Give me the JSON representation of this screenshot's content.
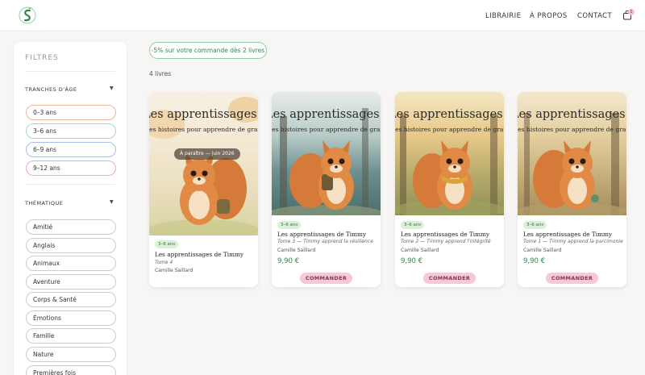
{
  "header": {
    "nav": [
      "LIBRAIRIE",
      "À PROPOS",
      "CONTACT"
    ],
    "cart_count": "1",
    "colors": {
      "accent": "#2f8a4a",
      "pink": "#f7c9d6"
    }
  },
  "sidebar": {
    "title": "FILTRES",
    "age_section": "TRANCHES D'ÂGE",
    "age_options": [
      "0–3 ans",
      "3–6 ans",
      "6–9 ans",
      "9–12 ans"
    ],
    "theme_section": "THÉMATIQUE",
    "theme_options": [
      "Amitié",
      "Anglais",
      "Animaux",
      "Aventure",
      "Corps & Santé",
      "Émotions",
      "Famille",
      "Nature",
      "Premières fois"
    ]
  },
  "main": {
    "promo": "-5% sur votre commande dès 2 livres",
    "count": "4 livres",
    "books": [
      {
        "cover_title": "Les apprentissages de Timmy",
        "cover_sub": "Des histoires pour apprendre de grandes",
        "coming": "À paraître — juin 2026",
        "age": "3–6 ans",
        "title": "Les apprentissages de Timmy",
        "subtitle": "Tome 4",
        "author": "Camille Saillard"
      },
      {
        "cover_title": "Les apprentissages de Timmy",
        "cover_sub": "Des histoires pour apprendre de grandes",
        "age": "3–6 ans",
        "title": "Les apprentissages de Timmy",
        "subtitle": "Tome 3 — Timmy apprend la résilience",
        "author": "Camille Saillard",
        "price": "9,90 €",
        "button": "COMMANDER"
      },
      {
        "cover_title": "Les apprentissages de Timmy",
        "cover_sub": "Des histoires pour apprendre de grandes",
        "age": "3–6 ans",
        "title": "Les apprentissages de Timmy",
        "subtitle": "Tome 2 — Timmy apprend l'intégrité",
        "author": "Camille Saillard",
        "price": "9,90 €",
        "button": "COMMANDER"
      },
      {
        "cover_title": "Les apprentissages de Timmy",
        "cover_sub": "Des histoires pour apprendre de grandes",
        "age": "3–6 ans",
        "title": "Les apprentissages de Timmy",
        "subtitle": "Tome 1 — Timmy apprend la parcimonie",
        "author": "Camille Saillard",
        "price": "9,90 €",
        "button": "COMMANDER"
      }
    ]
  }
}
